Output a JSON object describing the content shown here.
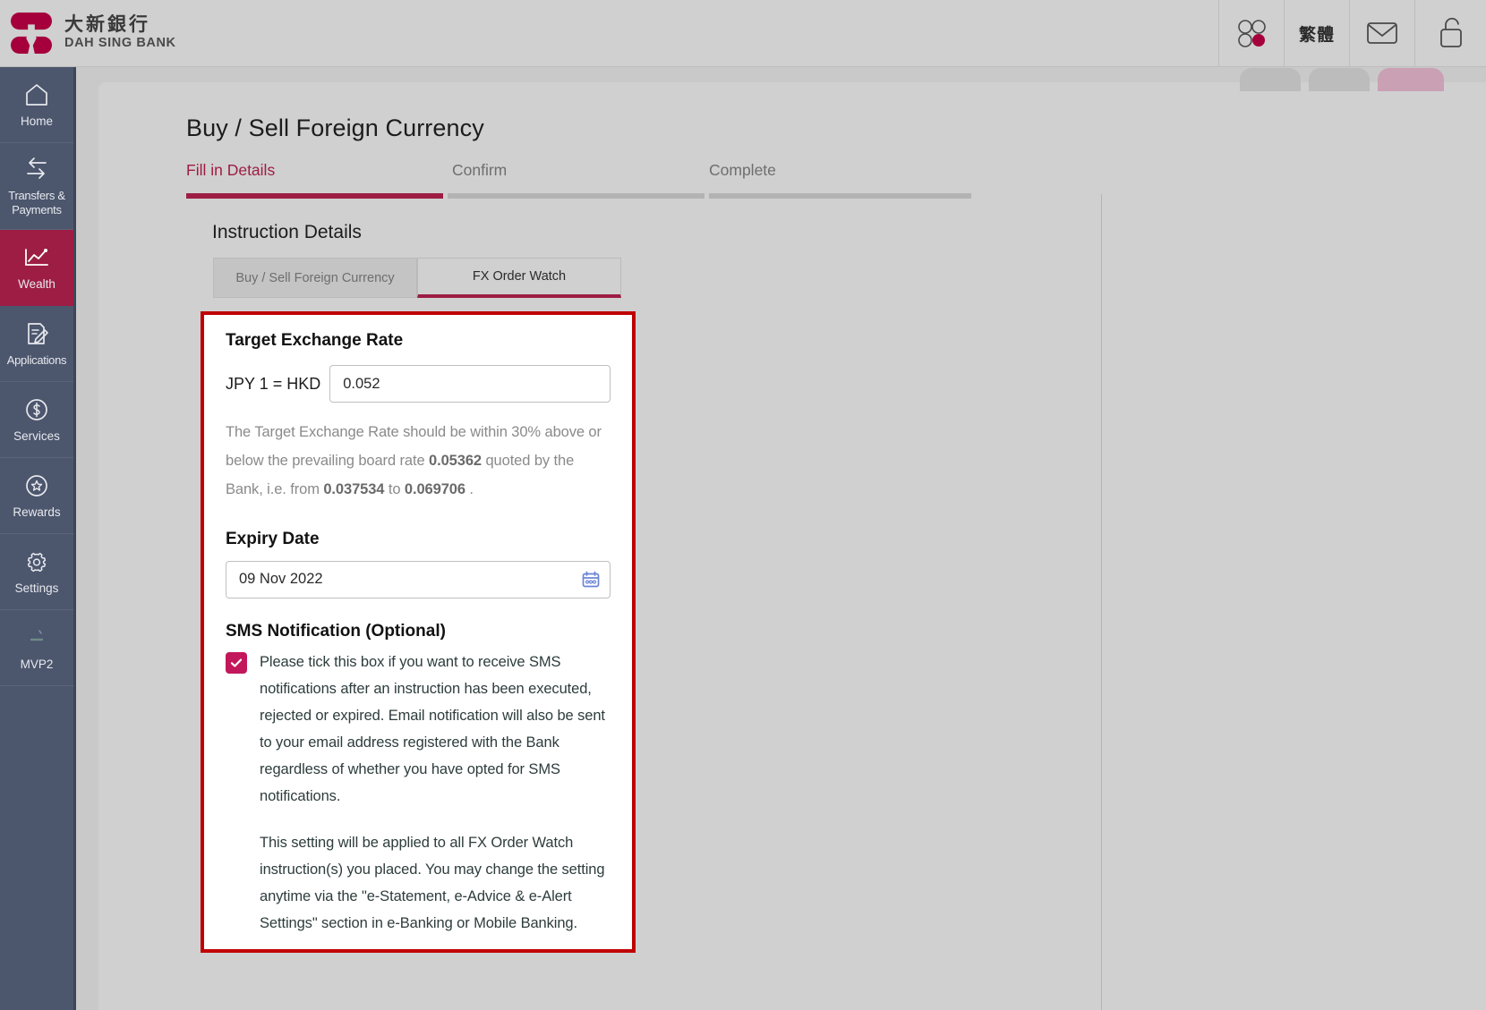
{
  "header": {
    "brand_cn": "大新銀行",
    "brand_en": "DAH SING BANK",
    "logo_icon": "dah-sing-logo",
    "actions": [
      {
        "name": "apps-icon",
        "label": "",
        "icon": "four-dots-icon"
      },
      {
        "name": "language-toggle",
        "label": "繁體",
        "icon": "language-text"
      },
      {
        "name": "messages-icon",
        "label": "",
        "icon": "envelope-icon"
      },
      {
        "name": "logout-icon",
        "label": "",
        "icon": "padlock-icon"
      }
    ],
    "pill_tabs": [
      "",
      "",
      ""
    ]
  },
  "sidebar": {
    "items": [
      {
        "label": "Home",
        "icon": "home-icon",
        "active": false
      },
      {
        "label": "Transfers &\nPayments",
        "icon": "transfer-arrows-icon",
        "active": false
      },
      {
        "label": "Wealth",
        "icon": "chart-line-icon",
        "active": true
      },
      {
        "label": "Applications",
        "icon": "form-pencil-icon",
        "active": false
      },
      {
        "label": "Services",
        "icon": "dollar-circle-icon",
        "active": false
      },
      {
        "label": "Rewards",
        "icon": "star-circle-icon",
        "active": false
      },
      {
        "label": "Settings",
        "icon": "gear-icon",
        "active": false
      },
      {
        "label": "MVP2",
        "icon": "mvp2-icon",
        "active": false
      }
    ]
  },
  "main": {
    "page_title": "Buy / Sell Foreign Currency",
    "steps": [
      {
        "label": "Fill in Details",
        "state": "current"
      },
      {
        "label": "Confirm",
        "state": "upcoming"
      },
      {
        "label": "Complete",
        "state": "upcoming"
      }
    ],
    "section_title": "Instruction Details",
    "tabs": [
      {
        "label": "Buy / Sell Foreign Currency",
        "active": false
      },
      {
        "label": "FX Order Watch",
        "active": true
      }
    ],
    "form": {
      "target_rate_heading": "Target Exchange Rate",
      "rate_pair_label": "JPY 1 = HKD",
      "rate_value": "0.052",
      "rate_placeholder": "",
      "helper_part1": "The Target Exchange Rate should be within 30% above or below the prevailing board rate ",
      "helper_board_rate": "0.05362",
      "helper_part2": " quoted by the Bank, i.e. from ",
      "helper_min": "0.037534",
      "helper_part3": " to ",
      "helper_max": "0.069706",
      "helper_part4": " .",
      "expiry_heading": "Expiry Date",
      "expiry_value": "09 Nov 2022",
      "expiry_placeholder": "",
      "calendar_icon": "calendar-icon",
      "sms_heading": "SMS Notification (Optional)",
      "sms_checked": true,
      "sms_paragraph_1": "Please tick this box if you want to receive SMS notifications after an instruction has been executed, rejected or expired. Email notification will also be sent to your email address registered with the Bank regardless of whether you have opted for SMS notifications.",
      "sms_paragraph_2": "This setting will be applied to all FX Order Watch instruction(s) you placed. You may change the setting anytime via the \"e-Statement, e-Advice & e-Alert Settings\" section in e-Banking or Mobile Banking."
    }
  },
  "colors": {
    "brand_red": "#9d1d44",
    "annotation_red": "#c00000",
    "checkbox_pink": "#c2185b",
    "sidebar_bg": "#4c566d",
    "page_bg": "#d0d0d0",
    "calendar_blue": "#6b84d6"
  }
}
